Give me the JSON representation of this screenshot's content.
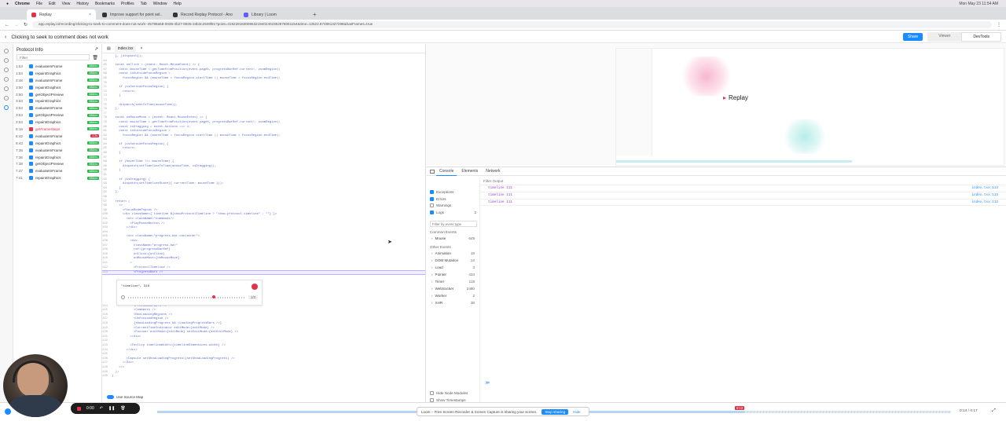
{
  "menubar": {
    "app": "Chrome",
    "items": [
      "File",
      "Edit",
      "View",
      "History",
      "Bookmarks",
      "Profiles",
      "Tab",
      "Window",
      "Help"
    ],
    "clock": "Mon May 23 11:54 AM"
  },
  "tabs": [
    {
      "label": "Replay",
      "active": true
    },
    {
      "label": "Improve support for point sel..."
    },
    {
      "label": "Record Replay Protocol - Ano..."
    },
    {
      "label": "Library | Loom"
    }
  ],
  "address": {
    "url": "app.replay.io/recording/clicking-to-seek-to-comment-does-not-work--45798a58-0038-4b27-8835-34b3c2949f81?point=31922818300863219402402352878061154&time=13522.874881327298&hasFrames=true"
  },
  "topbar": {
    "title": "Clicking to seek to comment does not work",
    "share_label": "Share",
    "viewer_label": "Viewer",
    "devtools_label": "DevTools"
  },
  "protocol": {
    "title": "Protocol Info",
    "filter_placeholder": "Filter",
    "rows": [
      {
        "time": "1:53",
        "name": "evaluateInFrame",
        "ms": "388ms"
      },
      {
        "time": "1:53",
        "name": "repaintGraphics",
        "ms": "388ms"
      },
      {
        "time": "3:48",
        "name": "evaluateInFrame",
        "ms": "388ms"
      },
      {
        "time": "3:50",
        "name": "repaintGraphics",
        "ms": "388ms"
      },
      {
        "time": "3:50",
        "name": "getObjectPreview",
        "ms": "388ms"
      },
      {
        "time": "3:53",
        "name": "repaintGraphics",
        "ms": "388ms"
      },
      {
        "time": "3:53",
        "name": "evaluateInFrame",
        "ms": "388ms"
      },
      {
        "time": "3:53",
        "name": "getObjectPreview",
        "ms": "388ms"
      },
      {
        "time": "3:53",
        "name": "repaintGraphics",
        "ms": "388ms"
      },
      {
        "time": "6:16",
        "name": "getFrameSteps",
        "ms": "388ms",
        "error": true
      },
      {
        "time": "6:42",
        "name": "evaluateInFrame",
        "ms": "1.2s",
        "slow": true
      },
      {
        "time": "6:43",
        "name": "repaintGraphics",
        "ms": "388ms"
      },
      {
        "time": "7:36",
        "name": "evaluateInFrame",
        "ms": "388ms"
      },
      {
        "time": "7:36",
        "name": "repaintGraphics",
        "ms": "388ms"
      },
      {
        "time": "7:38",
        "name": "getObjectPreview",
        "ms": "388ms"
      },
      {
        "time": "7:47",
        "name": "evaluateInFrame",
        "ms": "388ms"
      },
      {
        "time": "7:41",
        "name": "repaintGraphics",
        "ms": "388ms"
      }
    ]
  },
  "editor": {
    "file_tab": "index.tsx",
    "source_map_label": "Use Source Map",
    "code_top": [
      {
        "n": "",
        "t": "  }, [dispatch]);"
      },
      {
        "n": "64",
        "t": ""
      },
      {
        "n": "65",
        "t": "  const onClick = (event: React.MouseEvent) => {"
      },
      {
        "n": "67",
        "t": "    const mouseTime = getTimeFromPosition(event.pageX, progressBarRef.current!, zoomRegion);"
      },
      {
        "n": "68",
        "t": "    const isOutsideFocusRegion ="
      },
      {
        "n": "69",
        "t": "      focusRegion && (mouseTime < focusRegion.startTime || mouseTime > focusRegion.endTime);"
      },
      {
        "n": "70",
        "t": ""
      },
      {
        "n": "71",
        "t": "    if (isOutsideFocusRegion) {"
      },
      {
        "n": "72",
        "t": "      return;"
      },
      {
        "n": "73",
        "t": "    }"
      },
      {
        "n": "74",
        "t": ""
      },
      {
        "n": "75",
        "t": "    dispatch(seekToTime(mouseTime));"
      },
      {
        "n": "76",
        "t": "  };"
      },
      {
        "n": "77",
        "t": ""
      },
      {
        "n": "78",
        "t": "  const onMouseMove = (event: React.MouseEvent) => {"
      },
      {
        "n": "79",
        "t": "    const mouseTime = getTimeFromPosition(event.pageX, progressBarRef.current!, zoomRegion);"
      },
      {
        "n": "80",
        "t": "    const isDragging = event.buttons === 1;"
      },
      {
        "n": "81",
        "t": "    const isOutsideFocusRegion ="
      },
      {
        "n": "82",
        "t": "      focusRegion && (mouseTime < focusRegion.startTime || mouseTime > focusRegion.endTime);"
      },
      {
        "n": "83",
        "t": ""
      },
      {
        "n": "84",
        "t": "    if (isOutsideFocusRegion) {"
      },
      {
        "n": "85",
        "t": "      return;"
      },
      {
        "n": "86",
        "t": "    }"
      },
      {
        "n": "87",
        "t": ""
      },
      {
        "n": "88",
        "t": "    if (hoverTime !== mouseTime) {"
      },
      {
        "n": "89",
        "t": "      dispatch(setTimelineToTime(mouseTime, isDragging));"
      },
      {
        "n": "90",
        "t": "    }"
      },
      {
        "n": "91",
        "t": ""
      },
      {
        "n": "92",
        "t": "    if (isDragging) {"
      },
      {
        "n": "93",
        "t": "      dispatch(setTimelineState({ currentTime: mouseTime }));"
      },
      {
        "n": "94",
        "t": "    }"
      },
      {
        "n": "95",
        "t": "  };"
      },
      {
        "n": "96",
        "t": ""
      },
      {
        "n": "97",
        "t": "  return ("
      },
      {
        "n": "98",
        "t": "    <>"
      },
      {
        "n": "99",
        "t": "      <FocusModePopout />"
      },
      {
        "n": "100",
        "t": "      <div className={`timeline ${showProtocolTimeline ? \"show-protocol-timeline\" : \"\"}`}>"
      },
      {
        "n": "101",
        "t": "        <div className=\"commands\">"
      },
      {
        "n": "102",
        "t": "          <PlayPauseButton />"
      },
      {
        "n": "103",
        "t": "        </div>"
      },
      {
        "n": "104",
        "t": ""
      },
      {
        "n": "105",
        "t": "        <div className=\"progress-bar-container\">"
      },
      {
        "n": "106",
        "t": "          <div"
      },
      {
        "n": "107",
        "t": "            className=\"progress-bar\""
      },
      {
        "n": "108",
        "t": "            ref={progressBarRef}"
      },
      {
        "n": "109",
        "t": "            onClick={onClick}"
      },
      {
        "n": "110",
        "t": "            onMouseMove={onMouseMove}"
      },
      {
        "n": "111",
        "t": "          >"
      },
      {
        "n": "112",
        "t": "            <ProtocolTimeline />"
      },
      {
        "n": "113",
        "t": "            <ProgressBars />",
        "hl": true
      }
    ],
    "inline": {
      "label": "\"timeline\", 318",
      "counter": "1/3"
    },
    "code_bottom": [
      {
        "n": "114",
        "t": "            <PreviewMarkers />"
      },
      {
        "n": "115",
        "t": "            <Comments />"
      },
      {
        "n": "116",
        "t": "            <NonLoadingRegions />"
      },
      {
        "n": "117",
        "t": "            <UnfocusedRegion />"
      },
      {
        "n": "118",
        "t": "            {showLoadingProgress && <LoadingProgressBars />}"
      },
      {
        "n": "119",
        "t": "            <CurrentTimeIndicator editMode={editMode} />"
      },
      {
        "n": "120",
        "t": "            <Focuser editMode={editMode} setEditMode={setEditMode} />"
      },
      {
        "n": "121",
        "t": "          </div>"
      },
      {
        "n": "122",
        "t": ""
      },
      {
        "n": "123",
        "t": "          <Tooltip timelineWidth={timelineDimensions.width} />"
      },
      {
        "n": "124",
        "t": "        </div>"
      },
      {
        "n": "125",
        "t": ""
      },
      {
        "n": "126",
        "t": "        <Capsule setShowLoadingProgress={setShowLoadingProgress} />"
      },
      {
        "n": "127",
        "t": "      </div>"
      },
      {
        "n": "128",
        "t": "    </>"
      },
      {
        "n": "129",
        "t": "  );"
      },
      {
        "n": "130",
        "t": "}"
      }
    ]
  },
  "preview": {
    "logo_text": "Replay"
  },
  "devtools": {
    "tabs": [
      "Console",
      "Elements",
      "Network"
    ],
    "filter_output_placeholder": "Filter Output",
    "filters": [
      {
        "label": "Exceptions",
        "checked": true
      },
      {
        "label": "Errors",
        "checked": true
      },
      {
        "label": "Warnings",
        "checked": false
      },
      {
        "label": "Logs",
        "checked": true,
        "count": "2"
      }
    ],
    "event_filter_placeholder": "Filter by event type",
    "common_events_label": "Common Events",
    "common_events": [
      {
        "name": "Mouse",
        "count": "649"
      }
    ],
    "other_events_label": "Other Events",
    "other_events": [
      {
        "name": "Animation",
        "count": "19"
      },
      {
        "name": "DOM Mutation",
        "count": "14"
      },
      {
        "name": "Load",
        "count": "3"
      },
      {
        "name": "Pointer",
        "count": "434"
      },
      {
        "name": "Timer",
        "count": "118"
      },
      {
        "name": "WebSocket",
        "count": "2480"
      },
      {
        "name": "Worker",
        "count": "2"
      },
      {
        "name": "XHR",
        "count": "38"
      }
    ],
    "hide_node_modules": "Hide Node Modules",
    "show_timestamps": "Show Timestamps",
    "console_lines": [
      {
        "text": "timeline 111",
        "src": "index.tsx:113"
      },
      {
        "text": "timeline 111",
        "src": "index.tsx:113"
      },
      {
        "text": "timeline 111",
        "src": "index.tsx:113"
      }
    ],
    "prompt": "≫"
  },
  "timeline": {
    "time": "0:14 / 0:17",
    "marker": "0:12"
  },
  "loom": {
    "message": "Loom – Free Screen Recorder & Screen Capture is sharing your screen.",
    "stop_label": "Stop sharing",
    "hide_label": "Hide"
  },
  "recorder": {
    "elapsed": "0:00"
  },
  "colors": {
    "accent": "#1a8cff",
    "success": "#2db84d",
    "error": "#e0334a",
    "console_log": "#9b46c9"
  }
}
